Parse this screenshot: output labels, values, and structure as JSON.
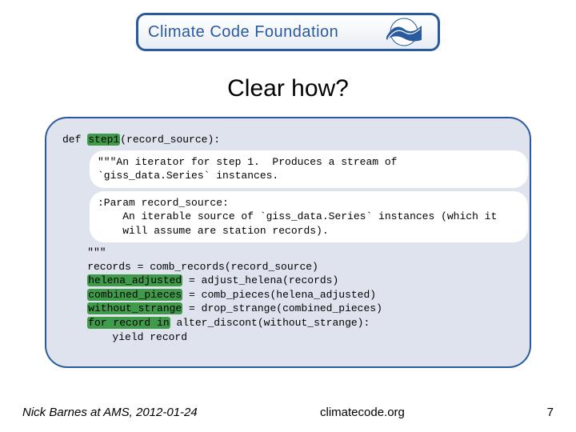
{
  "logo": {
    "text": "Climate Code Foundation"
  },
  "title": "Clear how?",
  "code": {
    "def_pre": "def ",
    "def_hl": "step1",
    "def_post": "(record_source):",
    "doc1_l1": "\"\"\"An iterator for step 1.  Produces a stream of",
    "doc1_l2": "`giss_data.Series` instances.",
    "doc2_l1": ":Param record_source:",
    "doc2_l2": "    An iterable source of `giss_data.Series` instances (which it",
    "doc2_l3": "    will assume are station records).",
    "qend": "    \"\"\"",
    "l1_pre": "    records = comb_records(record_source)",
    "l2_hl": "helena_adjusted",
    "l2_post": " = adjust_helena(records)",
    "l3_hl": "combined_pieces",
    "l3_post": " = comb_pieces(helena_adjusted)",
    "l4_hl": "without_strange",
    "l4_post": " = drop_strange(combined_pieces)",
    "l5_hl": "for record in",
    "l5_post": " alter_discont(without_strange):",
    "l6": "        yield record"
  },
  "footer": {
    "left": "Nick Barnes at AMS, 2012-01-24",
    "center": "climatecode.org",
    "right": "7"
  }
}
